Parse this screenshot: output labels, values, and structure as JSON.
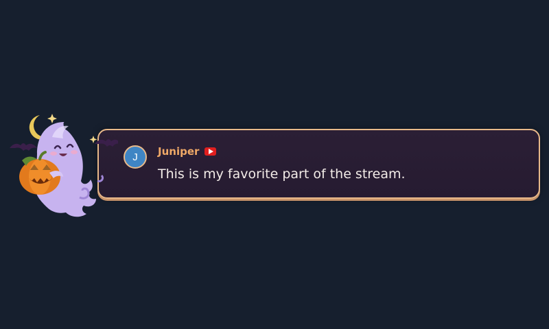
{
  "chat_message": {
    "avatar_initial": "J",
    "username": "Juniper",
    "platform_icon": "youtube-icon",
    "text": "This is my favorite part of the stream."
  },
  "mascot": {
    "icon": "halloween-ghost-pumpkin-icon"
  },
  "colors": {
    "background": "#161f2e",
    "card_background": "#2b1f35",
    "card_border": "#e8b98a",
    "username": "#f0a967",
    "avatar": "#3f85c4",
    "youtube_red": "#e01f1f",
    "message_text": "#f3ece8"
  }
}
